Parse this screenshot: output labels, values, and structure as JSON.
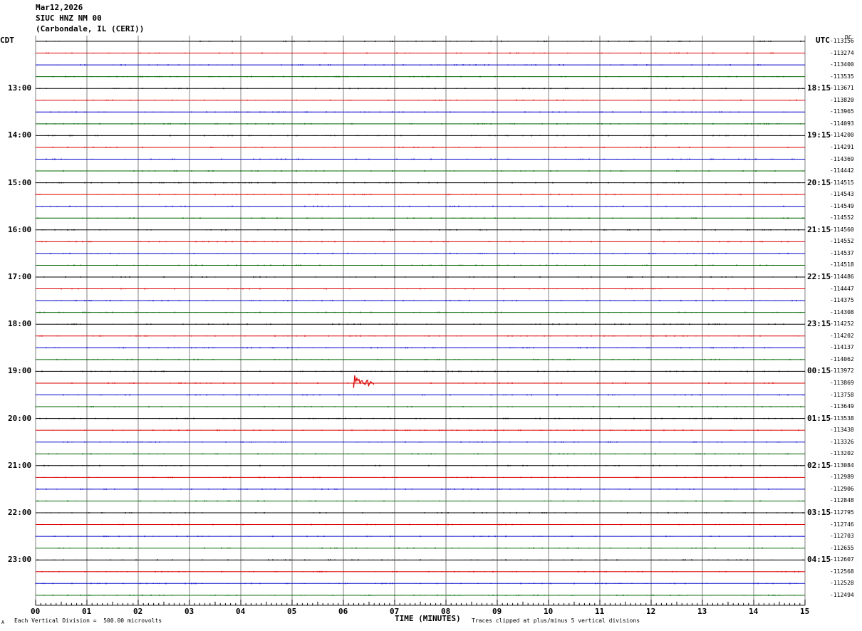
{
  "header": {
    "date": "Mar12,2026",
    "station": "SIUC HNZ NM 00",
    "location": "(Carbondale, IL (CERI))"
  },
  "left_axis_label": "CDT",
  "right_axis_label": "UTC",
  "dc_label": "DC",
  "footer": {
    "scale_note": "Each Vertical Division =  500.00 microvolts",
    "clip_note": "Traces clipped at plus/minus 5 vertical divisions",
    "corner_mark": "A"
  },
  "chart_data": {
    "type": "line",
    "title": "",
    "xlabel": "TIME (MINUTES)",
    "ylabel": "",
    "xlim": [
      0,
      15
    ],
    "x_ticks": [
      "00",
      "01",
      "02",
      "03",
      "04",
      "05",
      "06",
      "07",
      "08",
      "09",
      "10",
      "11",
      "12",
      "13",
      "14",
      "15"
    ],
    "left_time_labels": [
      "13:00",
      "14:00",
      "15:00",
      "16:00",
      "17:00",
      "18:00",
      "19:00",
      "20:00",
      "21:00",
      "22:00",
      "23:00"
    ],
    "right_time_labels": [
      "18:15",
      "19:15",
      "20:15",
      "21:15",
      "22:15",
      "23:15",
      "00:15",
      "01:15",
      "02:15",
      "03:15",
      "04:15"
    ],
    "trace_colors": [
      "#000000",
      "#dd0000",
      "#0000cc",
      "#006600"
    ],
    "trace_offsets": [
      -113156,
      -113274,
      -113400,
      -113535,
      -113671,
      -113820,
      -113965,
      -114093,
      -114200,
      -114291,
      -114369,
      -114442,
      -114515,
      -114543,
      -114549,
      -114552,
      -114560,
      -114552,
      -114537,
      -114518,
      -114486,
      -114447,
      -114375,
      -114308,
      -114252,
      -114202,
      -114137,
      -114062,
      -113972,
      -113869,
      -113758,
      -113649,
      -113538,
      -113438,
      -113326,
      -113202,
      -113084,
      -112989,
      -112906,
      -112848,
      -112795,
      -112746,
      -112703,
      -112655,
      -112607,
      -112568,
      -112528,
      -112494
    ],
    "event": {
      "trace_index": 29,
      "minute_start": 6.2,
      "minute_end": 6.6
    }
  }
}
